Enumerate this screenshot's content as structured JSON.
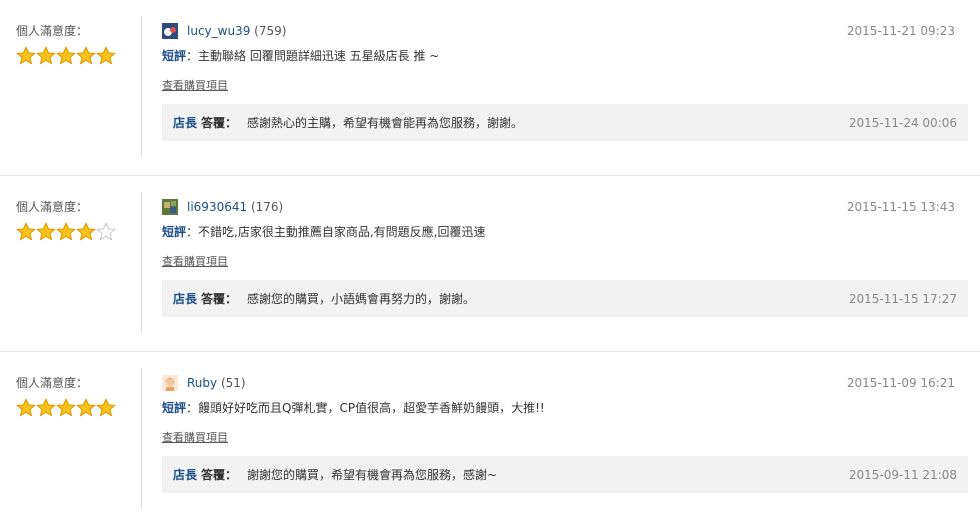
{
  "reviews": [
    {
      "satisfaction_label": "個人滿意度：",
      "rating": 5,
      "username": "lucy_wu39",
      "user_count": "(759)",
      "date": "2015-11-21 09:23",
      "short_label": "短評",
      "short_text": "：主動聯絡 回覆問題詳細迅速 五星級店長 推 ~",
      "items_link": "查看購買項目",
      "reply_owner": "店長",
      "reply_label": "答覆：",
      "reply_text": "感謝熱心的主購，希望有機會能再為您服務，謝謝。",
      "reply_date": "2015-11-24 00:06"
    },
    {
      "satisfaction_label": "個人滿意度：",
      "rating": 4,
      "username": "li6930641",
      "user_count": "(176)",
      "date": "2015-11-15 13:43",
      "short_label": "短評",
      "short_text": "：不錯吃,店家很主動推薦自家商品,有問題反應,回覆迅速",
      "items_link": "查看購買項目",
      "reply_owner": "店長",
      "reply_label": "答覆：",
      "reply_text": "感謝您的購買，小語媽會再努力的，謝謝。",
      "reply_date": "2015-11-15 17:27"
    },
    {
      "satisfaction_label": "個人滿意度：",
      "rating": 5,
      "username": "Ruby",
      "user_count": "(51)",
      "date": "2015-11-09 16:21",
      "short_label": "短評",
      "short_text": "：饅頭好好吃而且Q彈札實，CP值很高，超愛芋香鮮奶饅頭，大推!!",
      "items_link": "查看購買項目",
      "reply_owner": "店長",
      "reply_label": "答覆：",
      "reply_text": "謝謝您的購買，希望有機會再為您服務，感謝~",
      "reply_date": "2015-09-11 21:08"
    }
  ],
  "colors": {
    "star_fill": "#f7c21a",
    "star_stroke": "#d99a00",
    "link": "#1a4f8a",
    "reply_bg": "#f2f2f2"
  }
}
